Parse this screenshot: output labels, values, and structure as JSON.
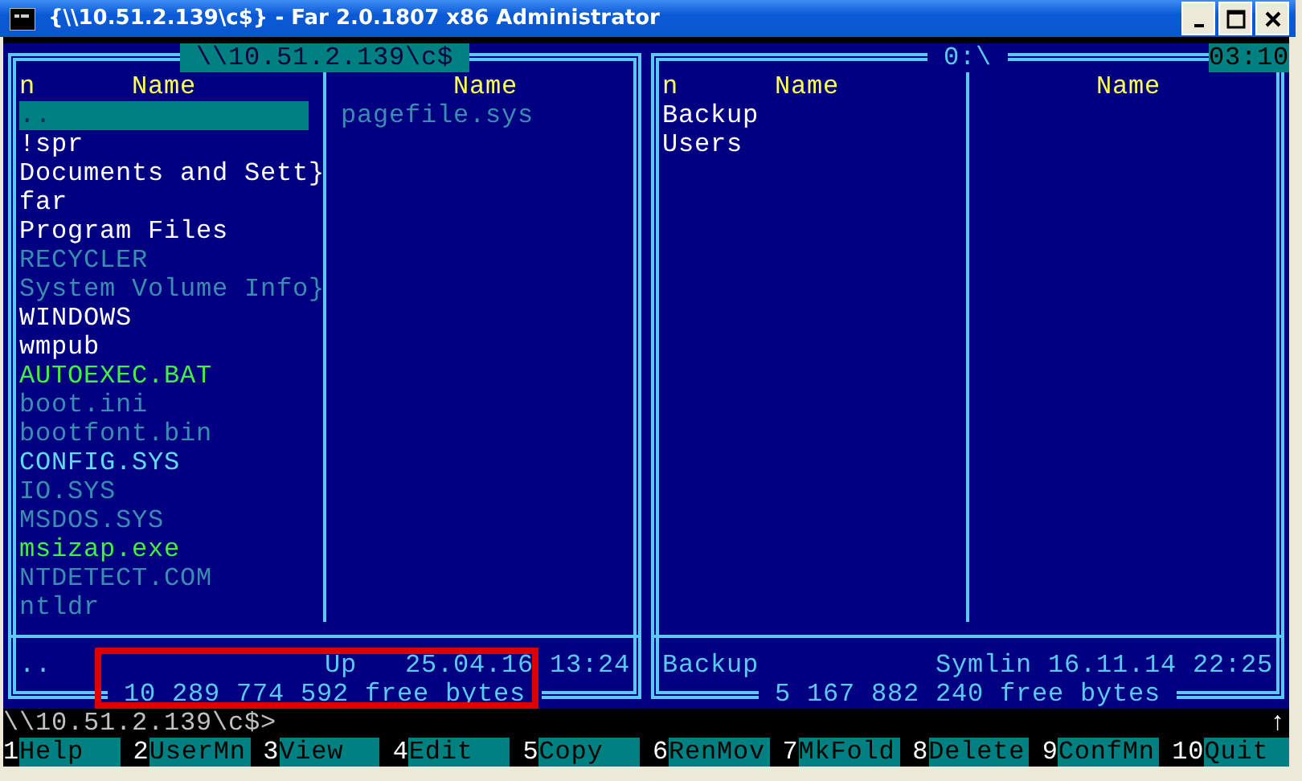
{
  "window": {
    "title": "{\\\\10.51.2.139\\c$} - Far 2.0.1807 x86 Administrator"
  },
  "clock": "03:10",
  "panels": [
    {
      "title": "\\\\10.51.2.139\\c$",
      "active": true,
      "sort_mark": "n",
      "columns": [
        {
          "header": "Name",
          "items": [
            {
              "name": "..",
              "selected": true
            },
            {
              "name": "!spr",
              "color": "#ffffff",
              "selected": false
            },
            {
              "name": "Documents and Sett}",
              "color": "#ffffff",
              "selected": false
            },
            {
              "name": "far",
              "color": "#ffffff",
              "selected": false
            },
            {
              "name": "Program Files",
              "color": "#ffffff",
              "selected": false
            },
            {
              "name": "RECYCLER",
              "color": "#3a8cb0",
              "selected": false
            },
            {
              "name": "System Volume Info}",
              "color": "#3a8cb0",
              "selected": false
            },
            {
              "name": "WINDOWS",
              "color": "#ffffff",
              "selected": false
            },
            {
              "name": "wmpub",
              "color": "#ffffff",
              "selected": false
            },
            {
              "name": "AUTOEXEC.BAT",
              "color": "#44ee44",
              "selected": false
            },
            {
              "name": "boot.ini",
              "color": "#3a8cb0",
              "selected": false
            },
            {
              "name": "bootfont.bin",
              "color": "#3a8cb0",
              "selected": false
            },
            {
              "name": "CONFIG.SYS",
              "color": "#60d8ff",
              "selected": false
            },
            {
              "name": "IO.SYS",
              "color": "#3a8cb0",
              "selected": false
            },
            {
              "name": "MSDOS.SYS",
              "color": "#3a8cb0",
              "selected": false
            },
            {
              "name": "msizap.exe",
              "color": "#44ee44",
              "selected": false
            },
            {
              "name": "NTDETECT.COM",
              "color": "#3a8cb0",
              "selected": false
            },
            {
              "name": "ntldr",
              "color": "#3a8cb0",
              "selected": false
            }
          ]
        },
        {
          "header": "Name",
          "items": [
            {
              "name": "pagefile.sys",
              "color": "#3a8cb0",
              "selected": false
            }
          ]
        }
      ],
      "status": {
        "name": "..",
        "type": "Up",
        "date": "25.04.16 13:24"
      },
      "free_space": "10 289 774 592 free bytes"
    },
    {
      "title": "0:\\",
      "active": false,
      "sort_mark": "n",
      "columns": [
        {
          "header": "Name",
          "items": [
            {
              "name": "Backup",
              "color": "#ffffff",
              "selected": false
            },
            {
              "name": "Users",
              "color": "#ffffff",
              "selected": false
            }
          ]
        },
        {
          "header": "Name"
        }
      ],
      "status": {
        "name": "Backup",
        "type": "Symlin",
        "date": "16.11.14 22:25"
      },
      "free_space": "5 167 882 240 free bytes"
    }
  ],
  "command_line": {
    "prompt": "\\\\10.51.2.139\\c$>"
  },
  "scroll_indicator": "↑",
  "keybar": [
    {
      "key": "1",
      "label": "Help"
    },
    {
      "key": "2",
      "label": "UserMn"
    },
    {
      "key": "3",
      "label": "View"
    },
    {
      "key": "4",
      "label": "Edit"
    },
    {
      "key": "5",
      "label": "Copy"
    },
    {
      "key": "6",
      "label": "RenMov"
    },
    {
      "key": "7",
      "label": "MkFold"
    },
    {
      "key": "8",
      "label": "Delete"
    },
    {
      "key": "9",
      "label": "ConfMn"
    },
    {
      "key": "10",
      "label": "Quit"
    }
  ],
  "annotations": [
    {
      "kind": "highlight-frame",
      "color": "#e00000"
    }
  ]
}
